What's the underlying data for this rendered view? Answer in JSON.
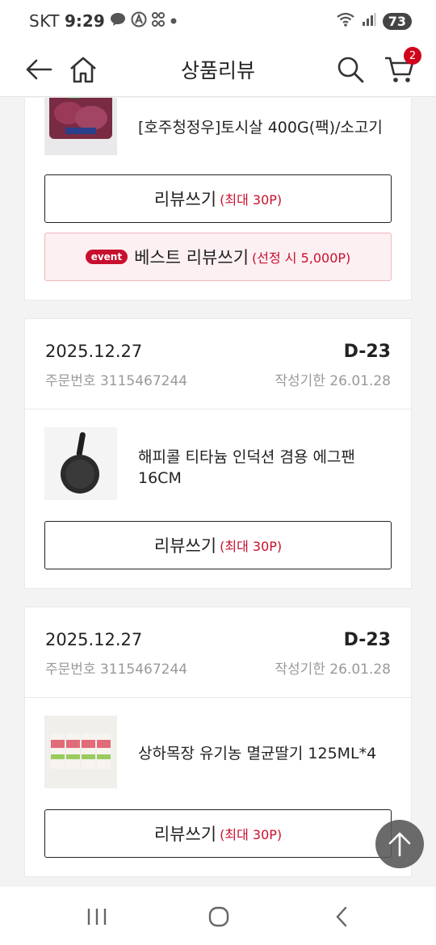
{
  "status_bar": {
    "carrier": "SKT",
    "time": "9:29",
    "icons": [
      "talk-icon",
      "a-icon",
      "cut-icon",
      "dot-icon"
    ],
    "wifi_label": "5",
    "battery": "73"
  },
  "header": {
    "title": "상품리뷰",
    "cart_count": "2",
    "icons": [
      "back-arrow-icon",
      "home-icon",
      "search-icon",
      "cart-icon"
    ]
  },
  "cards": [
    {
      "product": {
        "name": "[호주청정우]토시살 400G(팩)/소고기"
      },
      "review_button": {
        "label": "리뷰쓰기",
        "sub": "(최대 30P)"
      },
      "best_button": {
        "tag": "event",
        "label": "베스트 리뷰쓰기",
        "sub": "(선정 시 5,000P)"
      }
    },
    {
      "date": "2025.12.27",
      "dday": "D-23",
      "order_no": "주문번호 3115467244",
      "deadline": "작성기한 26.01.28",
      "product": {
        "name": "해피콜 티타늄 인덕션 겸용 에그팬 16CM"
      },
      "review_button": {
        "label": "리뷰쓰기",
        "sub": "(최대 30P)"
      }
    },
    {
      "date": "2025.12.27",
      "dday": "D-23",
      "order_no": "주문번호 3115467244",
      "deadline": "작성기한 26.01.28",
      "product": {
        "name": "상하목장 유기농 멸균딸기 125ML*4"
      },
      "review_button": {
        "label": "리뷰쓰기",
        "sub": "(최대 30P)"
      }
    }
  ],
  "colors": {
    "accent": "#c8102e",
    "best_bg": "#fdf0f2",
    "border": "#e8e8e8"
  }
}
